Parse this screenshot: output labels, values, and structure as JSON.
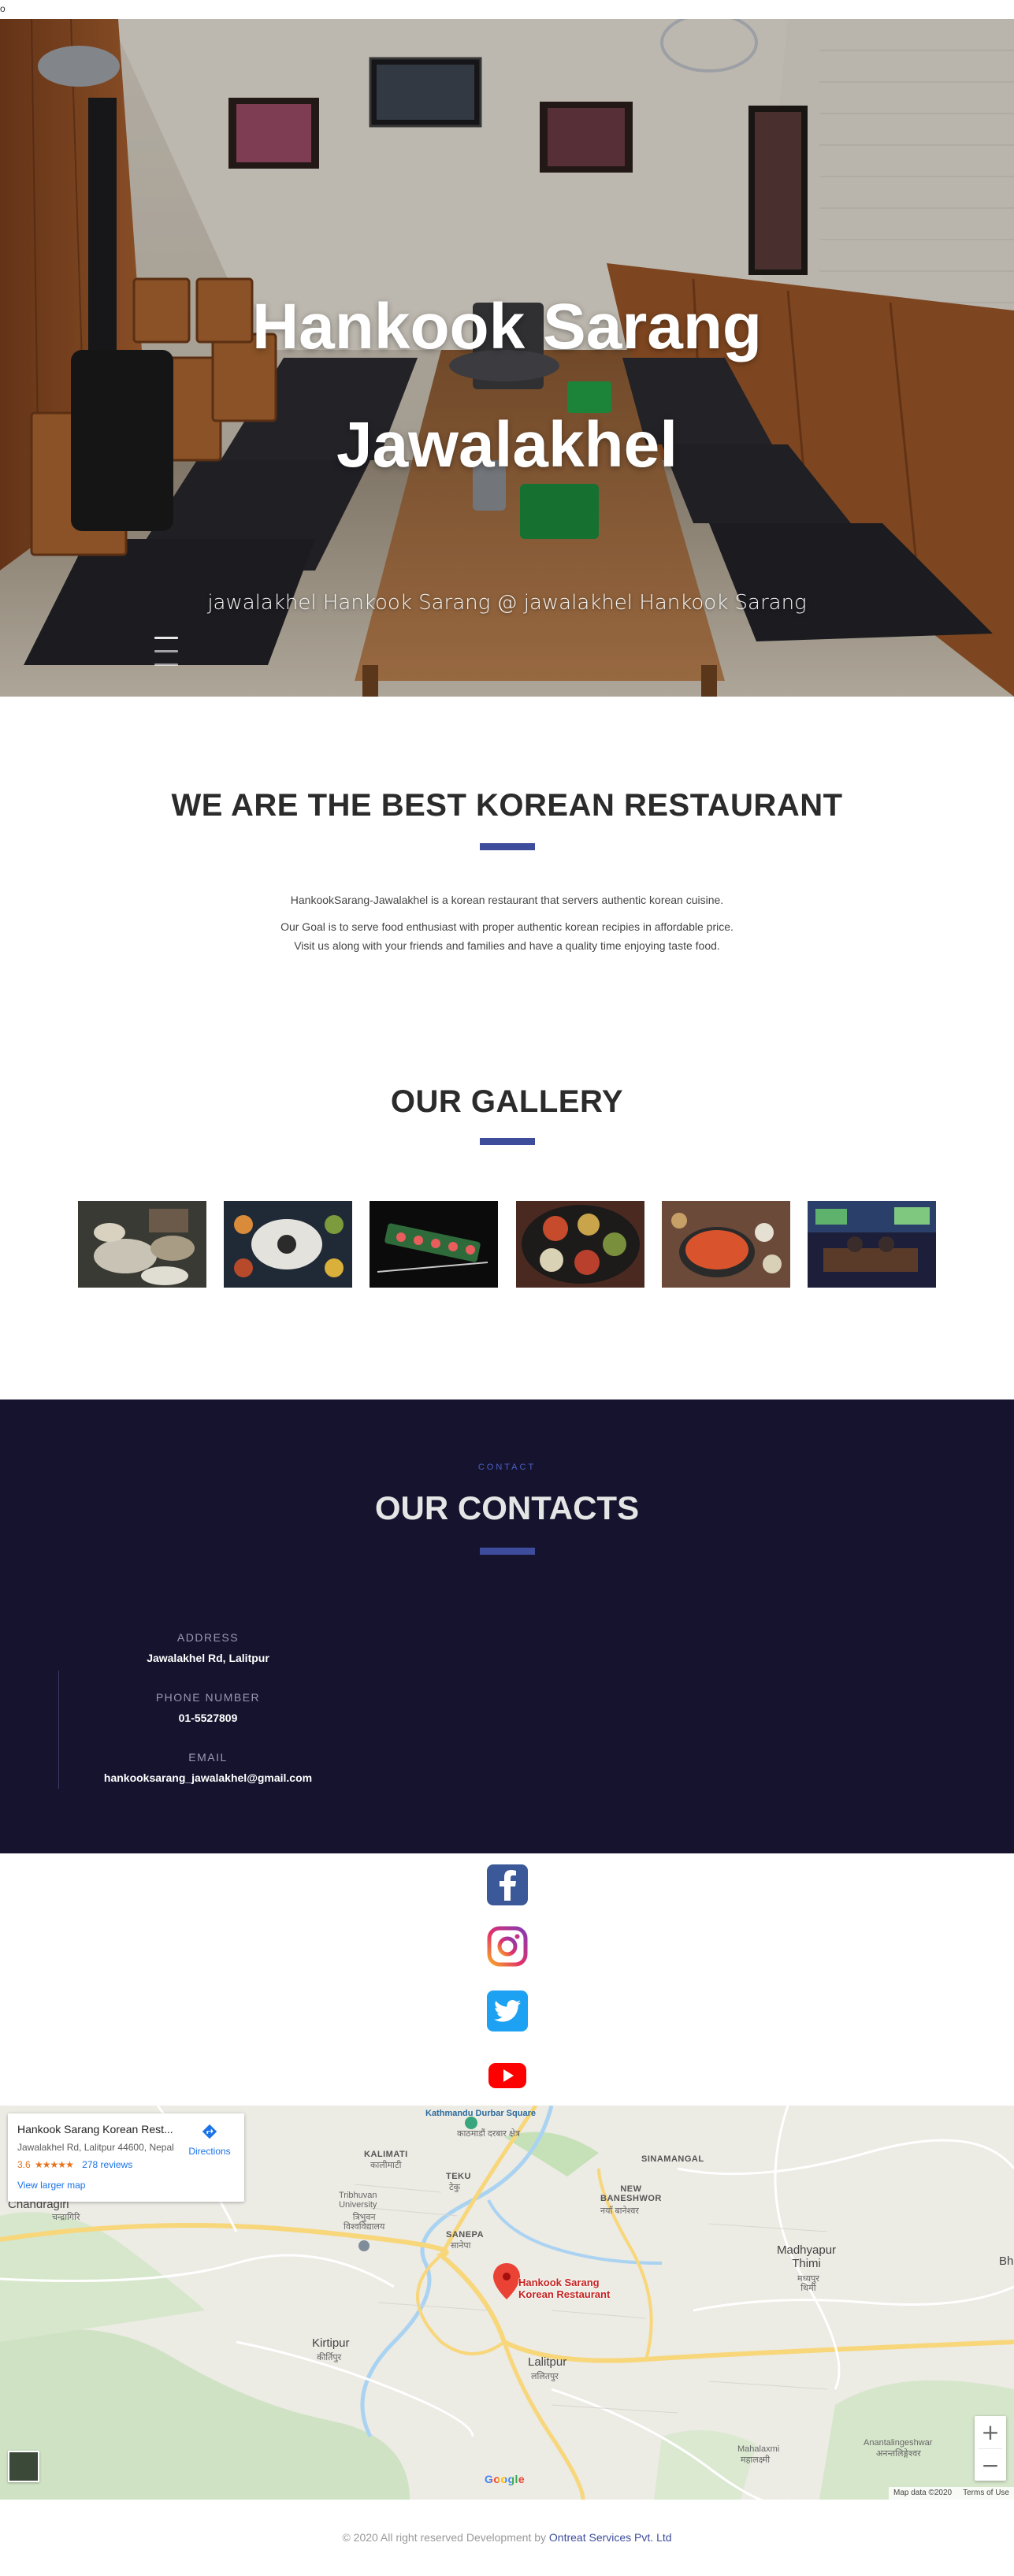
{
  "top_stub": {
    "text": "o"
  },
  "hero": {
    "title_line1": "Hankook Sarang",
    "title_line2": "Jawalakhel",
    "subtitle": "jawalakhel Hankook Sarang @ jawalakhel Hankook Sarang",
    "slide_count": 3
  },
  "about": {
    "heading": "WE ARE THE BEST KOREAN RESTAURANT",
    "line1": "HankookSarang-Jawalakhel is a korean restaurant that servers authentic korean cuisine.",
    "line2": "Our Goal is to serve food enthusiast with proper authentic korean recipies in affordable price.",
    "line3": "Visit us along with your friends and families and have a quality time enjoying taste food."
  },
  "gallery": {
    "heading": "OUR GALLERY",
    "items": [
      "gallery-photo-1",
      "gallery-photo-2",
      "gallery-photo-3",
      "gallery-photo-4",
      "gallery-photo-5",
      "gallery-photo-6"
    ]
  },
  "contacts": {
    "eyebrow": "CONTACT",
    "heading": "OUR CONTACTS",
    "address_label": "ADDRESS",
    "address_value": "Jawalakhel Rd, Lalitpur",
    "phone_label": "PHONE NUMBER",
    "phone_value": "01-5527809",
    "email_label": "EMAIL",
    "email_value": "hankooksarang_jawalakhel@gmail.com"
  },
  "social": {
    "facebook": "facebook-icon",
    "instagram": "instagram-icon",
    "twitter": "twitter-icon",
    "youtube": "youtube-icon",
    "colors": {
      "facebook": "#3b5998",
      "twitter": "#1da1f2",
      "youtube": "#ff0000"
    }
  },
  "map": {
    "card_name": "Hankook Sarang Korean Rest...",
    "card_address": "Jawalakhel Rd, Lalitpur 44600, Nepal",
    "rating": "3.6",
    "stars": "★★★★★",
    "reviews": "278 reviews",
    "directions": "Directions",
    "larger_map": "View larger map",
    "pin_label_1": "Hankook Sarang",
    "pin_label_2": "Korean Restaurant",
    "labels": {
      "kathmandu_durbar": "Kathmandu\nDurbar Square",
      "kathmandu_durbar_np": "काठमाडौं\nदरबार क्षेत्र",
      "kalimati": "KALIMATI",
      "kalimati_np": "कालीमाटी",
      "teku": "TEKU",
      "teku_np": "टेकु",
      "sinamangal": "SINAMANGAL",
      "new_baneshwor": "NEW\nBANESHWOR",
      "new_baneshwor_np": "नयाँ बानेश्वर",
      "chandragiri": "Chandragiri",
      "chandragiri_np": "चन्द्रागिरि",
      "tribhuvan": "Tribhuvan\nUniversity",
      "tribhuvan_np": "त्रिभुवन\nविश्वविद्यालय",
      "sanepa": "SANEPA",
      "sanepa_np": "सानेपा",
      "madhyapur": "Madhyapur\nThimi",
      "madhyapur_np": "मध्यपुर\nथिमी",
      "kirtipur": "Kirtipur",
      "kirtipur_np": "कीर्तिपुर",
      "lalitpur": "Lalitpur",
      "lalitpur_np": "ललितपुर",
      "mahalaxmi": "Mahalaxmi",
      "mahalaxmi_np": "महालक्ष्मी",
      "anantalingeshwar": "Anantalingeshwar",
      "anantalingeshwar_np": "अनन्तलिङ्गेश्वर",
      "bh": "Bh"
    },
    "zoom_in": "+",
    "zoom_out": "−",
    "map_data": "Map data ©2020",
    "terms": "Terms of Use",
    "google": "Google"
  },
  "footer": {
    "text": "© 2020 All right reserved Development by ",
    "link": "Ontreat Services Pvt. Ltd"
  }
}
